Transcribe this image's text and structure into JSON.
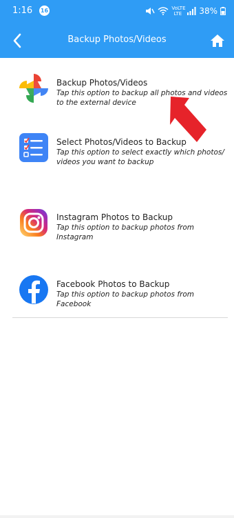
{
  "status_bar": {
    "time": "1:16",
    "notification_count": "16",
    "battery_percent": "38%",
    "network_label": "VoLTE LTE"
  },
  "header": {
    "title": "Backup Photos/Videos",
    "back_icon": "back-arrow-icon",
    "home_icon": "home-icon",
    "color": "#2f9cf5"
  },
  "menu": {
    "items": [
      {
        "title": "Backup Photos/Videos",
        "description": "Tap this option to backup all photos and videos to the external device",
        "icon": "google-photos-icon"
      },
      {
        "title": "Select Photos/Videos to Backup",
        "description": "Tap this option to select exactly which photos/ videos you want to backup",
        "icon": "checklist-icon"
      },
      {
        "title": "Instagram Photos to Backup",
        "description": "Tap this option to backup photos from Instagram",
        "icon": "instagram-icon"
      },
      {
        "title": "Facebook Photos to Backup",
        "description": "Tap this option to backup photos from Facebook",
        "icon": "facebook-icon"
      }
    ]
  },
  "annotation": {
    "arrow_icon": "red-pointer-arrow-icon",
    "color": "#e6232a"
  }
}
